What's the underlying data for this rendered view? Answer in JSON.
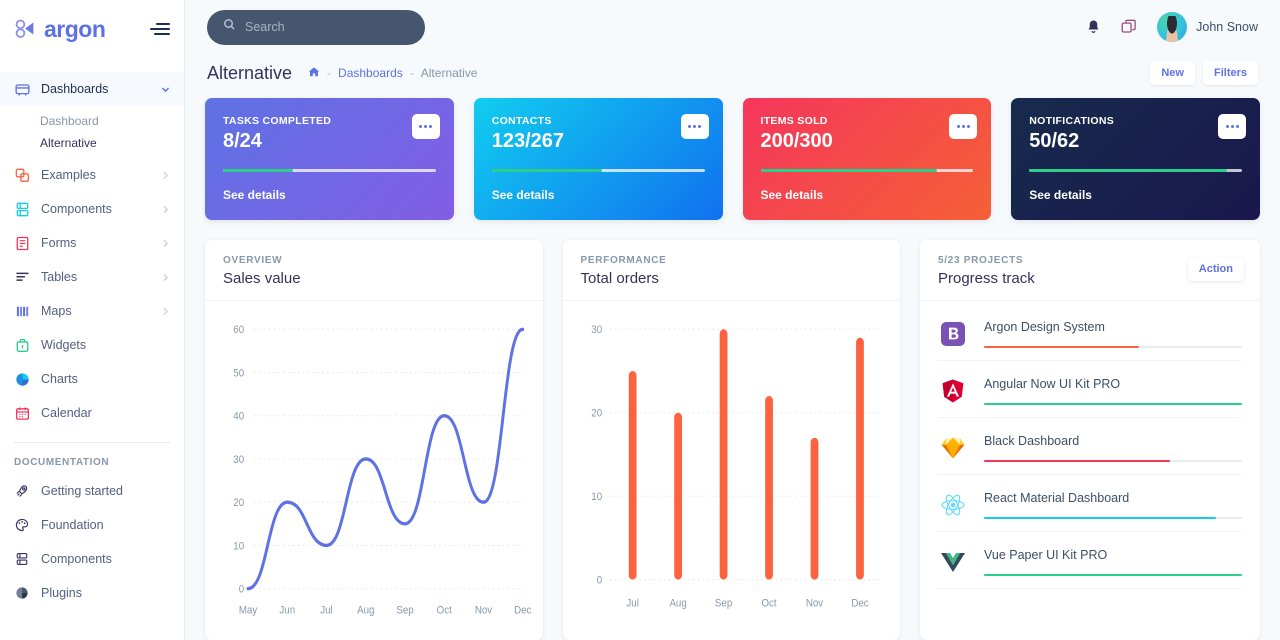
{
  "brand": {
    "name": "argon",
    "logo_icon": "argon-logo-icon",
    "menu_icon": "hamburger-menu-icon"
  },
  "sidebar": {
    "items": [
      {
        "label": "Dashboards",
        "icon": "dashboard-icon",
        "active": true,
        "has_caret": true
      },
      {
        "label": "Examples",
        "icon": "examples-icon",
        "active": false,
        "has_caret": true
      },
      {
        "label": "Components",
        "icon": "components-icon",
        "active": false,
        "has_caret": true
      },
      {
        "label": "Forms",
        "icon": "forms-icon",
        "active": false,
        "has_caret": true
      },
      {
        "label": "Tables",
        "icon": "tables-icon",
        "active": false,
        "has_caret": true
      },
      {
        "label": "Maps",
        "icon": "maps-icon",
        "active": false,
        "has_caret": true
      },
      {
        "label": "Widgets",
        "icon": "widgets-icon",
        "active": false,
        "has_caret": false
      },
      {
        "label": "Charts",
        "icon": "charts-icon",
        "active": false,
        "has_caret": false
      },
      {
        "label": "Calendar",
        "icon": "calendar-icon",
        "active": false,
        "has_caret": false
      }
    ],
    "sub_items": [
      {
        "label": "Dashboard",
        "active": false
      },
      {
        "label": "Alternative",
        "active": true
      }
    ],
    "documentation_heading": "DOCUMENTATION",
    "doc_items": [
      {
        "label": "Getting started",
        "icon": "rocket-icon"
      },
      {
        "label": "Foundation",
        "icon": "palette-icon"
      },
      {
        "label": "Components",
        "icon": "components-icon"
      },
      {
        "label": "Plugins",
        "icon": "plugins-icon"
      }
    ]
  },
  "topbar": {
    "search_placeholder": "Search",
    "search_value": "",
    "search_icon": "search-icon",
    "bell_icon": "bell-icon",
    "cards_icon": "cards-icon",
    "user_name": "John Snow",
    "avatar": "user-avatar"
  },
  "page": {
    "title": "Alternative",
    "breadcrumb": {
      "home_icon": "home-icon",
      "sep": "-",
      "parent": "Dashboards",
      "current": "Alternative"
    },
    "buttons": {
      "new": "New",
      "filters": "Filters"
    }
  },
  "stats": [
    {
      "label": "TASKS COMPLETED",
      "value": "8/24",
      "link": "See details",
      "progress": 33,
      "gradient_from": "#5e72e4",
      "gradient_to": "#825ee4",
      "bar_color": "#2dce89",
      "menu_icon": "ellipsis-icon"
    },
    {
      "label": "CONTACTS",
      "value": "123/267",
      "link": "See details",
      "progress": 52,
      "gradient_from": "#11cdef",
      "gradient_to": "#1171ef",
      "bar_color": "#2dce89",
      "menu_icon": "ellipsis-icon"
    },
    {
      "label": "ITEMS SOLD",
      "value": "200/300",
      "link": "See details",
      "progress": 83,
      "gradient_from": "#f5365c",
      "gradient_to": "#f56036",
      "bar_color": "#2dce89",
      "menu_icon": "ellipsis-icon"
    },
    {
      "label": "NOTIFICATIONS",
      "value": "50/62",
      "link": "See details",
      "progress": 93,
      "gradient_from": "#172b4d",
      "gradient_to": "#1a174d",
      "bar_color": "#2dce89",
      "menu_icon": "ellipsis-icon"
    }
  ],
  "panels": {
    "sales": {
      "subtitle": "OVERVIEW",
      "title": "Sales value"
    },
    "orders": {
      "subtitle": "PERFORMANCE",
      "title": "Total orders"
    },
    "progress": {
      "subtitle": "5/23 PROJECTS",
      "title": "Progress track",
      "action_label": "Action"
    }
  },
  "projects": [
    {
      "name": "Argon Design System",
      "icon": "bootstrap-icon",
      "progress": 60,
      "bar_color": "#fb6340"
    },
    {
      "name": "Angular Now UI Kit PRO",
      "icon": "angular-icon",
      "progress": 100,
      "bar_color": "#2dce89"
    },
    {
      "name": "Black Dashboard",
      "icon": "sketch-icon",
      "progress": 72,
      "bar_color": "#f5365c"
    },
    {
      "name": "React Material Dashboard",
      "icon": "react-icon",
      "progress": 90,
      "bar_color": "#11cdef"
    },
    {
      "name": "Vue Paper UI Kit PRO",
      "icon": "vue-icon",
      "progress": 100,
      "bar_color": "#2dce89"
    }
  ],
  "chart_data": [
    {
      "type": "line",
      "title": "Sales value",
      "subtitle": "OVERVIEW",
      "categories": [
        "May",
        "Jun",
        "Jul",
        "Aug",
        "Sep",
        "Oct",
        "Nov",
        "Dec"
      ],
      "values": [
        0,
        20,
        10,
        30,
        15,
        40,
        20,
        60
      ],
      "series": [
        {
          "name": "Sales value",
          "values": [
            0,
            20,
            10,
            30,
            15,
            40,
            20,
            60
          ]
        }
      ],
      "yticks": [
        0,
        10,
        20,
        30,
        40,
        50,
        60
      ],
      "ylim": [
        0,
        60
      ],
      "xlabel": "",
      "ylabel": "",
      "grid": true,
      "legend": "none",
      "line_color": "#5e72e4"
    },
    {
      "type": "bar",
      "title": "Total orders",
      "subtitle": "PERFORMANCE",
      "categories": [
        "Jul",
        "Aug",
        "Sep",
        "Oct",
        "Nov",
        "Dec"
      ],
      "values": [
        25,
        20,
        30,
        22,
        17,
        29
      ],
      "series": [
        {
          "name": "Total orders",
          "values": [
            25,
            20,
            30,
            22,
            17,
            29
          ]
        }
      ],
      "yticks": [
        0,
        10,
        20,
        30
      ],
      "ylim": [
        0,
        30
      ],
      "xlabel": "",
      "ylabel": "",
      "grid": true,
      "legend": "none",
      "bar_color": "#fb6340"
    }
  ]
}
